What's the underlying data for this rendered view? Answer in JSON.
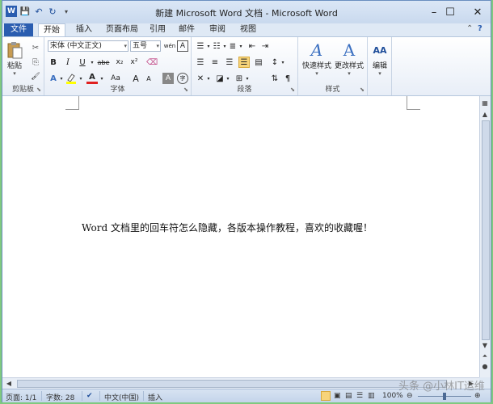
{
  "window": {
    "title": "新建 Microsoft Word 文档 - Microsoft Word",
    "minimize": "–",
    "maximize": "☐",
    "close": "✕"
  },
  "qat": {
    "word_icon": "W",
    "save": "💾",
    "undo": "↶",
    "redo": "↻",
    "customize": "▾"
  },
  "tabs": {
    "file": "文件",
    "items": [
      "开始",
      "插入",
      "页面布局",
      "引用",
      "邮件",
      "审阅",
      "视图"
    ],
    "active": "开始"
  },
  "ribbon": {
    "clipboard": {
      "label": "剪贴板",
      "paste": "粘贴",
      "cut": "✂",
      "copy": "⎘",
      "format_painter": "🖌"
    },
    "font": {
      "label": "字体",
      "font_name": "宋体 (中文正文)",
      "font_size": "五号",
      "bold": "B",
      "italic": "I",
      "underline": "U",
      "strike": "abe",
      "subscript": "x₂",
      "superscript": "x²",
      "grow": "A",
      "shrink": "A",
      "case": "Aa",
      "clear": "A",
      "phonetic": "wén",
      "border_char": "A",
      "char_shade": "A",
      "enclose": "字"
    },
    "paragraph": {
      "label": "段落"
    },
    "styles": {
      "label": "样式",
      "quick_styles": "快速样式",
      "change_styles": "更改样式"
    },
    "editing": {
      "label": "",
      "editing": "编辑"
    }
  },
  "document": {
    "text": "Word 文档里的回车符怎么隐藏，各版本操作教程，喜欢的收藏喔！"
  },
  "status": {
    "page": "页面: 1/1",
    "words": "字数: 28",
    "language": "中文(中国)",
    "mode": "插入",
    "zoom": "100%"
  },
  "watermark": "头条 @小林IT运维",
  "colors": {
    "file_tab": "#2a5db0",
    "accent": "#1f4e9a",
    "highlight": "#f7d47a"
  }
}
